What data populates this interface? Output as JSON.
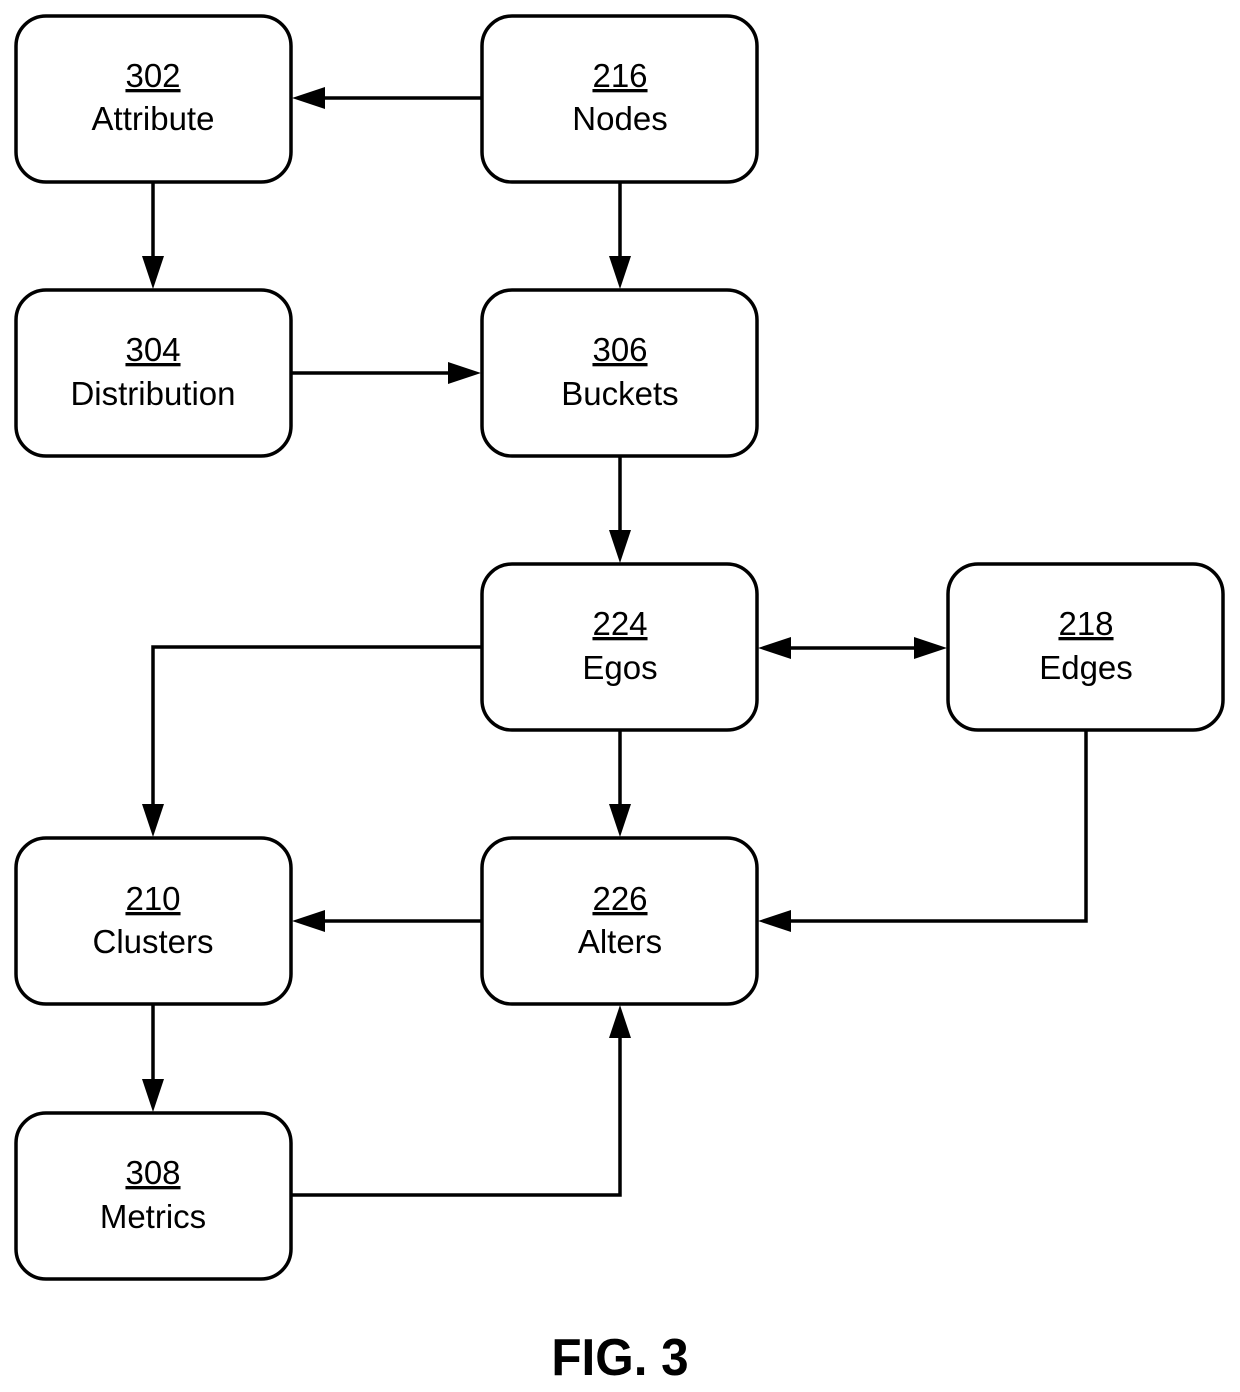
{
  "figure_label": "FIG. 3",
  "nodes": [
    {
      "id": "302",
      "label": "Attribute"
    },
    {
      "id": "216",
      "label": "Nodes"
    },
    {
      "id": "304",
      "label": "Distribution"
    },
    {
      "id": "306",
      "label": "Buckets"
    },
    {
      "id": "224",
      "label": "Egos"
    },
    {
      "id": "218",
      "label": "Edges"
    },
    {
      "id": "210",
      "label": "Clusters"
    },
    {
      "id": "226",
      "label": "Alters"
    },
    {
      "id": "308",
      "label": "Metrics"
    }
  ],
  "connections": [
    {
      "from": "216",
      "to": "302",
      "direction": "forward"
    },
    {
      "from": "302",
      "to": "304",
      "direction": "forward"
    },
    {
      "from": "216",
      "to": "306",
      "direction": "forward"
    },
    {
      "from": "304",
      "to": "306",
      "direction": "forward"
    },
    {
      "from": "306",
      "to": "224",
      "direction": "forward"
    },
    {
      "from": "224",
      "to": "218",
      "direction": "bidirectional"
    },
    {
      "from": "224",
      "to": "210",
      "direction": "forward"
    },
    {
      "from": "224",
      "to": "226",
      "direction": "forward"
    },
    {
      "from": "218",
      "to": "226",
      "direction": "forward"
    },
    {
      "from": "226",
      "to": "210",
      "direction": "forward"
    },
    {
      "from": "210",
      "to": "308",
      "direction": "forward"
    },
    {
      "from": "308",
      "to": "226",
      "direction": "forward"
    }
  ]
}
